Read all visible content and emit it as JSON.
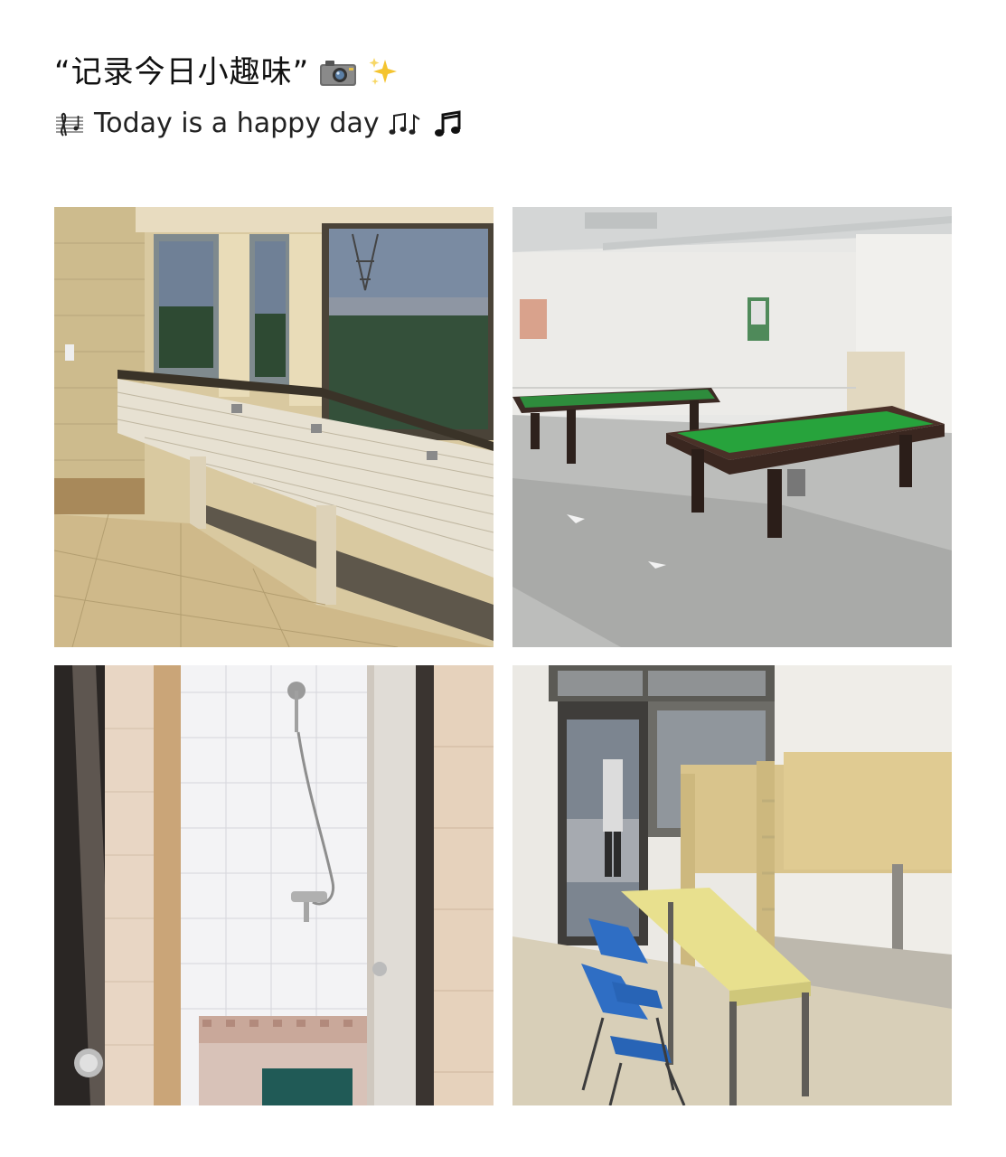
{
  "post": {
    "title": "“记录今日小趣味”",
    "title_icons": [
      "camera-icon",
      "sparkles-icon"
    ],
    "subtitle": "Today is a happy day",
    "subtitle_lead_icon": "music-score-icon",
    "subtitle_trail_icons": [
      "music-notes-icon",
      "music-note-icon"
    ]
  },
  "photos": [
    {
      "name": "washroom-sink-photo"
    },
    {
      "name": "billiards-room-photo"
    },
    {
      "name": "shower-stall-photo"
    },
    {
      "name": "dorm-bunk-room-photo"
    }
  ]
}
